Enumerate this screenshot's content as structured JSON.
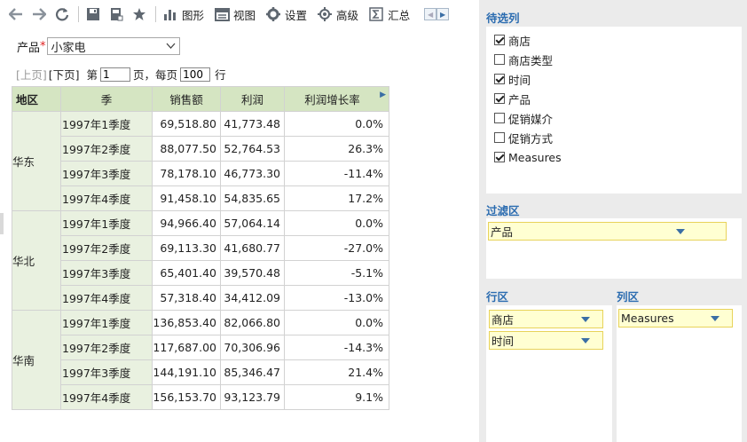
{
  "toolbar": {
    "chart_label": "图形",
    "view_label": "视图",
    "settings_label": "设置",
    "advanced_label": "高级",
    "summary_label": "汇总"
  },
  "filter": {
    "product_label": "产品",
    "required_mark": "*",
    "product_value": "小家电"
  },
  "pager": {
    "prev_label": "[上页]",
    "next_label": "[下页]",
    "page_prefix": "第",
    "page_value": "1",
    "page_suffix": "页，每页",
    "rows_value": "100",
    "rows_suffix": "行"
  },
  "table": {
    "headers": [
      "地区",
      "季",
      "销售额",
      "利润",
      "利润增长率"
    ],
    "groups": [
      {
        "region": "华东",
        "rows": [
          {
            "quarter": "1997年1季度",
            "sales": "69,518.80",
            "profit": "41,773.48",
            "growth": "0.0%"
          },
          {
            "quarter": "1997年2季度",
            "sales": "88,077.50",
            "profit": "52,764.53",
            "growth": "26.3%"
          },
          {
            "quarter": "1997年3季度",
            "sales": "78,178.10",
            "profit": "46,773.30",
            "growth": "-11.4%"
          },
          {
            "quarter": "1997年4季度",
            "sales": "91,458.10",
            "profit": "54,835.65",
            "growth": "17.2%"
          }
        ]
      },
      {
        "region": "华北",
        "rows": [
          {
            "quarter": "1997年1季度",
            "sales": "94,966.40",
            "profit": "57,064.14",
            "growth": "0.0%"
          },
          {
            "quarter": "1997年2季度",
            "sales": "69,113.30",
            "profit": "41,680.77",
            "growth": "-27.0%"
          },
          {
            "quarter": "1997年3季度",
            "sales": "65,401.40",
            "profit": "39,570.48",
            "growth": "-5.1%"
          },
          {
            "quarter": "1997年4季度",
            "sales": "57,318.40",
            "profit": "34,412.09",
            "growth": "-13.0%"
          }
        ]
      },
      {
        "region": "华南",
        "rows": [
          {
            "quarter": "1997年1季度",
            "sales": "136,853.40",
            "profit": "82,066.80",
            "growth": "0.0%"
          },
          {
            "quarter": "1997年2季度",
            "sales": "117,687.00",
            "profit": "70,306.96",
            "growth": "-14.3%"
          },
          {
            "quarter": "1997年3季度",
            "sales": "144,191.10",
            "profit": "85,346.47",
            "growth": "21.4%"
          },
          {
            "quarter": "1997年4季度",
            "sales": "156,153.70",
            "profit": "93,123.79",
            "growth": "9.1%"
          }
        ]
      }
    ]
  },
  "panel": {
    "candidates_title": "待选列",
    "candidates": [
      {
        "label": "商店",
        "checked": true
      },
      {
        "label": "商店类型",
        "checked": false
      },
      {
        "label": "时间",
        "checked": true
      },
      {
        "label": "产品",
        "checked": true
      },
      {
        "label": "促销媒介",
        "checked": false
      },
      {
        "label": "促销方式",
        "checked": false
      },
      {
        "label": "Measures",
        "checked": true
      }
    ],
    "filter_title": "过滤区",
    "filter_items": [
      "产品"
    ],
    "rows_title": "行区",
    "row_items": [
      "商店",
      "时间"
    ],
    "cols_title": "列区",
    "col_items": [
      "Measures"
    ]
  },
  "colors": {
    "header_bg": "#d5e5c2",
    "row_header_bg": "#e9f1e0",
    "section_title": "#2b6cb0",
    "chip_bg": "#ffffd2",
    "chip_border": "#e8d35a"
  }
}
